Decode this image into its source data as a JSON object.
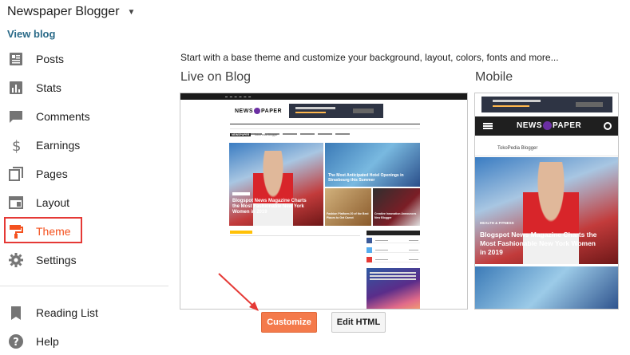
{
  "blog": {
    "title": "Newspaper Blogger",
    "view_blog": "View blog"
  },
  "sidebar": {
    "items": [
      {
        "label": "Posts",
        "icon": "posts-icon"
      },
      {
        "label": "Stats",
        "icon": "stats-icon"
      },
      {
        "label": "Comments",
        "icon": "comments-icon"
      },
      {
        "label": "Earnings",
        "icon": "dollar-icon"
      },
      {
        "label": "Pages",
        "icon": "pages-icon"
      },
      {
        "label": "Layout",
        "icon": "layout-icon"
      },
      {
        "label": "Theme",
        "icon": "paint-roller-icon",
        "active": true
      },
      {
        "label": "Settings",
        "icon": "gear-icon"
      }
    ],
    "footer_items": [
      {
        "label": "Reading List",
        "icon": "bookmark-icon"
      },
      {
        "label": "Help",
        "icon": "help-icon"
      }
    ],
    "active_color": "#f4511e",
    "highlight_color": "#e53935"
  },
  "main": {
    "intro": "Start with a base theme and customize your background, layout, colors, fonts and more...",
    "live_title": "Live on Blog",
    "mobile_title": "Mobile",
    "buttons": {
      "customize": "Customize",
      "edit_html": "Edit HTML"
    },
    "accent": "#f47a4b"
  },
  "preview": {
    "logo_left": "NEWS",
    "logo_right": "PAPER",
    "desktop_label_tag": "NEWSPAPER",
    "desktop_label": "TokoPedia Blogger",
    "hero_caption": "Blogspot News Magazine Charts the Most Fashionable New York Women in 2019",
    "swim_caption": "The Most Anticipated Hotel Openings in Strasbourg this Summer",
    "food_caption": "Fashion Platform 20 of the Best Places to Get Carrot",
    "shoes_caption": "Creative Innovation Announces New Blogger",
    "mobile_blogger": "TokoPedia Blogger",
    "mobile_tag": "HEALTH & FITNESS",
    "mobile_caption": "Blogspot News Magazine Charts the Most Fashionable New York Women in 2019"
  }
}
